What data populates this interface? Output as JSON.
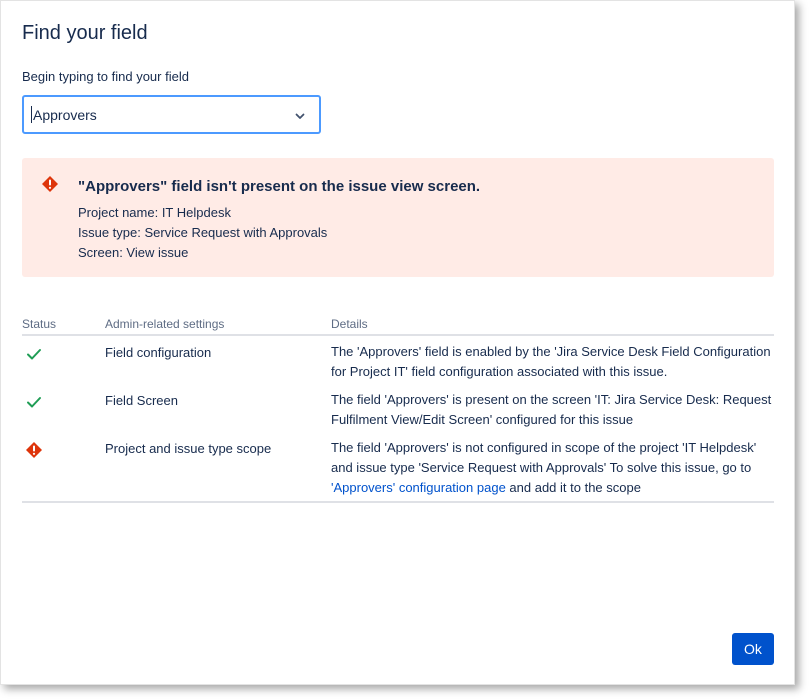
{
  "dialog": {
    "title": "Find your field",
    "field_label": "Begin typing to find your field",
    "select_value": "Approvers",
    "ok_label": "Ok"
  },
  "alert": {
    "heading": "\"Approvers\" field isn't present on the issue view screen.",
    "lines": [
      "Project name: IT Helpdesk",
      "Issue type: Service Request with Approvals",
      "Screen: View issue"
    ],
    "color": "#ffebe6"
  },
  "table": {
    "headers": [
      "Status",
      "Admin-related settings",
      "Details"
    ],
    "rows": [
      {
        "status": "check-icon",
        "setting": "Field configuration",
        "details": "The 'Approvers' field is enabled by the 'Jira Service Desk Field Configuration for Project IT' field configuration associated with this issue."
      },
      {
        "status": "check-icon",
        "setting": "Field Screen",
        "details": "The field 'Approvers' is present on the screen 'IT: Jira Service Desk: Request Fulfilment View/Edit Screen' configured for this issue"
      },
      {
        "status": "error-icon",
        "setting": "Project and issue type scope",
        "details_prefix": "The field 'Approvers' is not configured in scope of the project 'IT Helpdesk' and issue type 'Service Request with Approvals' To solve this issue, go to ",
        "details_link": "'Approvers' configuration page",
        "details_suffix": " and add it to the scope"
      }
    ]
  },
  "colors": {
    "primary": "#0052cc",
    "success": "#36b37e",
    "error": "#de350b",
    "focus": "#4c9aff"
  }
}
